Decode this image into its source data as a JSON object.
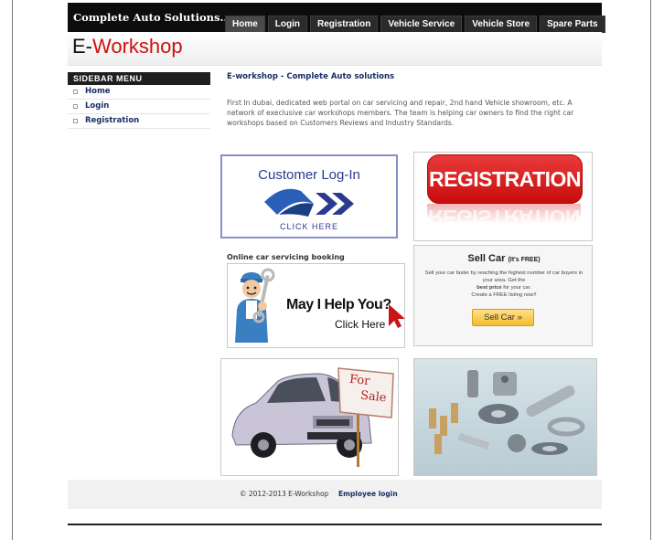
{
  "header": {
    "site_name": "Complete Auto Solutions...",
    "logo_prefix": "E-",
    "logo_suffix": "Workshop",
    "nav": [
      "Home",
      "Login",
      "Registration",
      "Vehicle Service",
      "Vehicle Store",
      "Spare Parts"
    ],
    "active_nav": "Home"
  },
  "sidebar": {
    "title": "SIDEBAR MENU",
    "items": [
      {
        "label": "Home",
        "icon": "square-bullet-icon"
      },
      {
        "label": "Login",
        "icon": "square-bullet-icon"
      },
      {
        "label": "Registration",
        "icon": "square-bullet-icon"
      }
    ]
  },
  "main": {
    "title": "E-workshop - Complete Auto solutions",
    "intro": "First In dubai, dedicated web portal on car servicing and repair, 2nd hand Vehicle showroom, etc. A network of execlusive car workshops members. The team is helping car owners to find the right car workshops based on Customers Reviews and Industry Standards.",
    "customer_login": {
      "title": "Customer Log-In",
      "cta": "CLICK HERE"
    },
    "registration_banner": "REGISTRATION",
    "booking_label": "Online car servicing booking",
    "help_banner": {
      "line1": "May I Help You?",
      "line2": "Click Here"
    },
    "sell_car": {
      "title": "Sell Car",
      "free_note": "(It's FREE)",
      "desc_line1": "Sell your car faster by reaching the highest number of car buyers in your area. Get the",
      "desc_bold": "best price",
      "desc_line2": "for your car.",
      "desc_line3": "Create a FREE listing now!!",
      "button": "Sell Car »"
    },
    "for_sale_sign": {
      "line1": "For",
      "line2": "Sale"
    }
  },
  "footer": {
    "copyright": "© 2012-2013 E-Workshop",
    "employee_login": "Employee login"
  },
  "colors": {
    "accent_red": "#cc1111",
    "nav_bg": "#0d0d0d",
    "link_blue": "#1a2e66",
    "sell_button": "#f5bc2c"
  }
}
